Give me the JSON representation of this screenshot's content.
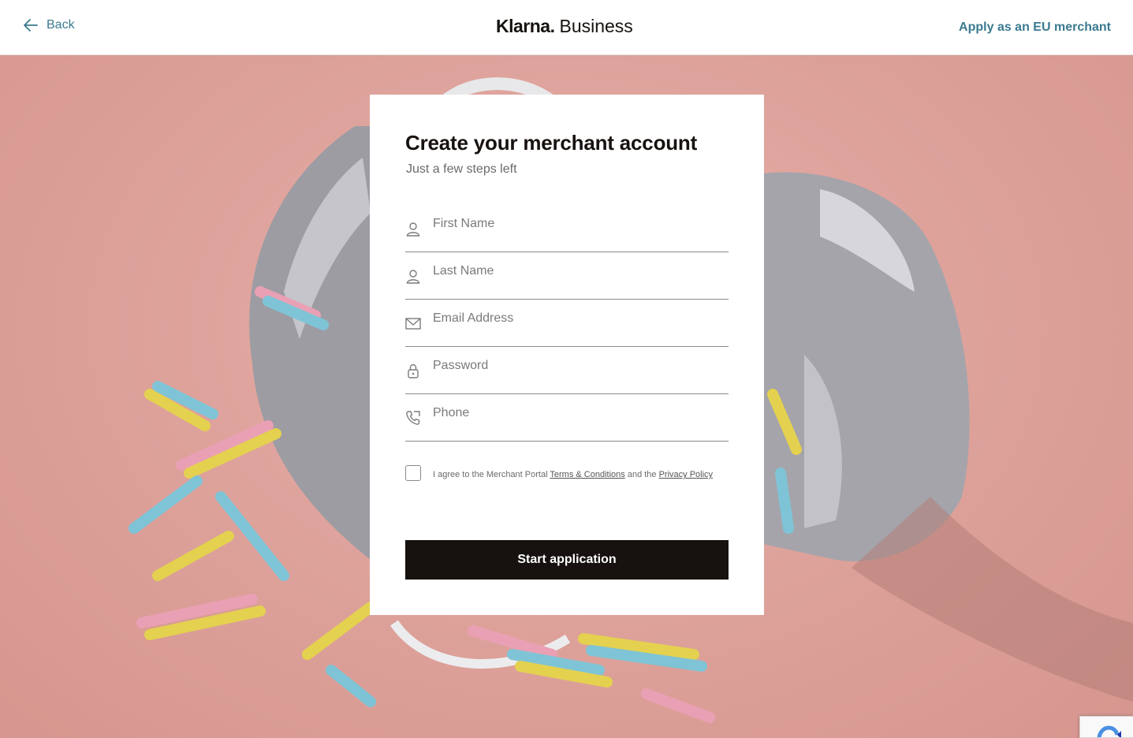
{
  "header": {
    "back_label": "Back",
    "logo_brand": "Klarna.",
    "logo_suffix": "Business",
    "eu_link": "Apply as an EU merchant"
  },
  "form": {
    "title": "Create your merchant account",
    "subtitle": "Just a few steps left",
    "fields": [
      {
        "placeholder": "First Name",
        "icon": "person-icon",
        "value": ""
      },
      {
        "placeholder": "Last Name",
        "icon": "person-icon",
        "value": ""
      },
      {
        "placeholder": "Email Address",
        "icon": "envelope-icon",
        "value": ""
      },
      {
        "placeholder": "Password",
        "icon": "lock-icon",
        "value": ""
      },
      {
        "placeholder": "Phone",
        "icon": "phone-icon",
        "value": ""
      }
    ],
    "agree_prefix": "I agree to the Merchant Portal",
    "terms_link": "Terms & Conditions",
    "agree_middle": "and the",
    "privacy_link": "Privacy Policy",
    "agree_checked": false,
    "submit_label": "Start application"
  },
  "colors": {
    "accent": "#3b7a8f",
    "button_bg": "#17120f",
    "hero_bg": "#dea39c"
  }
}
